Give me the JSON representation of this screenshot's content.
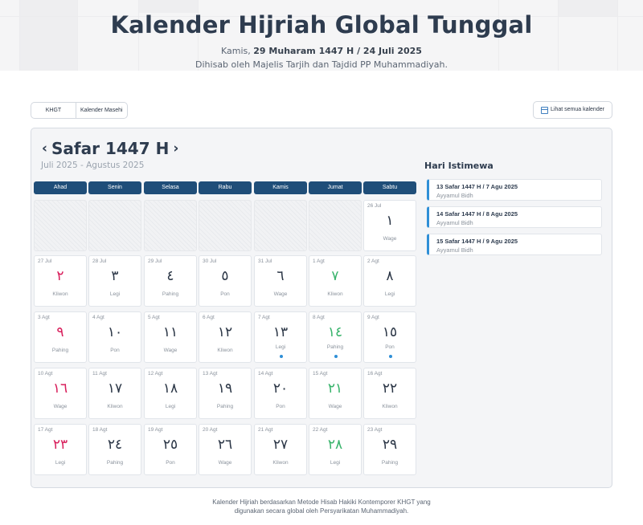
{
  "header": {
    "title": "Kalender Hijriah Global Tunggal",
    "today_prefix": "Kamis,",
    "today_value": "29 Muharam 1447 H / 24 Juli 2025",
    "subtitle": "Dihisab oleh Majelis Tarjih dan Tajdid PP Muhammadiyah."
  },
  "tabs": [
    {
      "label": "KHGT",
      "active": true
    },
    {
      "label": "Kalender Masehi",
      "active": false
    }
  ],
  "view_all": {
    "label": "Lihat semua kalender",
    "icon": "calendar-icon"
  },
  "calendar": {
    "prev_symbol": "‹",
    "next_symbol": "›",
    "month_title": "Safar 1447 H",
    "greg_range": "Juli 2025 - Agustus 2025",
    "weekdays": [
      "Ahad",
      "Senin",
      "Selasa",
      "Rabu",
      "Kamis",
      "Jumat",
      "Sabtu"
    ],
    "colors": {
      "sunday": "#d81e5b",
      "friday": "#38b36b",
      "header": "#1f4e79",
      "marker": "#2f8fd6"
    },
    "cells": [
      {
        "empty": true
      },
      {
        "empty": true
      },
      {
        "empty": true
      },
      {
        "empty": true
      },
      {
        "empty": true
      },
      {
        "empty": true
      },
      {
        "greg": "26 Jul",
        "hijri": "١",
        "pasaran": "Wage"
      },
      {
        "greg": "27 Jul",
        "hijri": "٢",
        "pasaran": "Kliwon"
      },
      {
        "greg": "28 Jul",
        "hijri": "٣",
        "pasaran": "Legi"
      },
      {
        "greg": "29 Jul",
        "hijri": "٤",
        "pasaran": "Pahing"
      },
      {
        "greg": "30 Jul",
        "hijri": "٥",
        "pasaran": "Pon"
      },
      {
        "greg": "31 Jul",
        "hijri": "٦",
        "pasaran": "Wage"
      },
      {
        "greg": "1 Agt",
        "hijri": "٧",
        "pasaran": "Kliwon"
      },
      {
        "greg": "2 Agt",
        "hijri": "٨",
        "pasaran": "Legi"
      },
      {
        "greg": "3 Agt",
        "hijri": "٩",
        "pasaran": "Pahing"
      },
      {
        "greg": "4 Agt",
        "hijri": "١٠",
        "pasaran": "Pon"
      },
      {
        "greg": "5 Agt",
        "hijri": "١١",
        "pasaran": "Wage"
      },
      {
        "greg": "6 Agt",
        "hijri": "١٢",
        "pasaran": "Kliwon"
      },
      {
        "greg": "7 Agt",
        "hijri": "١٣",
        "pasaran": "Legi",
        "special": true
      },
      {
        "greg": "8 Agt",
        "hijri": "١٤",
        "pasaran": "Pahing",
        "special": true
      },
      {
        "greg": "9 Agt",
        "hijri": "١٥",
        "pasaran": "Pon",
        "special": true
      },
      {
        "greg": "10 Agt",
        "hijri": "١٦",
        "pasaran": "Wage"
      },
      {
        "greg": "11 Agt",
        "hijri": "١٧",
        "pasaran": "Kliwon"
      },
      {
        "greg": "12 Agt",
        "hijri": "١٨",
        "pasaran": "Legi"
      },
      {
        "greg": "13 Agt",
        "hijri": "١٩",
        "pasaran": "Pahing"
      },
      {
        "greg": "14 Agt",
        "hijri": "٢٠",
        "pasaran": "Pon"
      },
      {
        "greg": "15 Agt",
        "hijri": "٢١",
        "pasaran": "Wage"
      },
      {
        "greg": "16 Agt",
        "hijri": "٢٢",
        "pasaran": "Kliwon"
      },
      {
        "greg": "17 Agt",
        "hijri": "٢٣",
        "pasaran": "Legi"
      },
      {
        "greg": "18 Agt",
        "hijri": "٢٤",
        "pasaran": "Pahing"
      },
      {
        "greg": "19 Agt",
        "hijri": "٢٥",
        "pasaran": "Pon"
      },
      {
        "greg": "20 Agt",
        "hijri": "٢٦",
        "pasaran": "Wage"
      },
      {
        "greg": "21 Agt",
        "hijri": "٢٧",
        "pasaran": "Kliwon"
      },
      {
        "greg": "22 Agt",
        "hijri": "٢٨",
        "pasaran": "Legi"
      },
      {
        "greg": "23 Agt",
        "hijri": "٢٩",
        "pasaran": "Pahing"
      }
    ]
  },
  "special_days": {
    "title": "Hari Istimewa",
    "items": [
      {
        "date": "13 Safar 1447 H / 7 Agu 2025",
        "name": "Ayyamul Bidh"
      },
      {
        "date": "14 Safar 1447 H / 8 Agu 2025",
        "name": "Ayyamul Bidh"
      },
      {
        "date": "15 Safar 1447 H / 9 Agu 2025",
        "name": "Ayyamul Bidh"
      }
    ]
  },
  "footer": {
    "line1": "Kalender Hijriah berdasarkan Metode Hisab Hakiki Kontemporer KHGT yang",
    "line2": "digunakan secara global oleh Persyarikatan Muhammadiyah."
  }
}
